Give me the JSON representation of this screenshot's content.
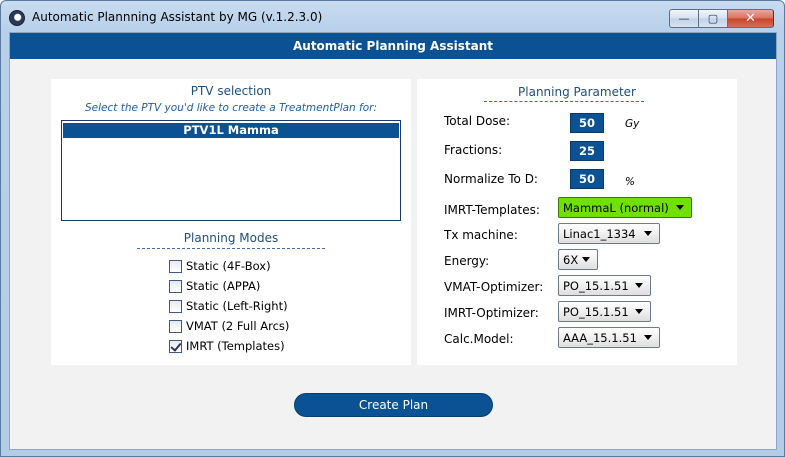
{
  "window": {
    "title": "Automatic Plannning Assistant by MG (v.1.2.3.0)",
    "minimize_glyph": "—",
    "maximize_glyph": "▢",
    "close_glyph": "✕"
  },
  "banner": {
    "title": "Automatic Planning Assistant"
  },
  "ptv": {
    "title": "PTV selection",
    "subtitle": "Select the PTV you'd like to create a TreatmentPlan for:",
    "items": [
      {
        "label": "PTV1L Mamma",
        "selected": true
      }
    ]
  },
  "modes": {
    "title": "Planning Modes",
    "options": [
      {
        "label": "Static (4F-Box)",
        "checked": false
      },
      {
        "label": "Static (APPA)",
        "checked": false
      },
      {
        "label": "Static (Left-Right)",
        "checked": false
      },
      {
        "label": "VMAT (2 Full Arcs)",
        "checked": false
      },
      {
        "label": "IMRT (Templates)",
        "checked": true
      }
    ]
  },
  "params": {
    "title": "Planning Parameter",
    "total_dose": {
      "label": "Total Dose:",
      "value": "50",
      "unit": "Gy"
    },
    "fractions": {
      "label": "Fractions:",
      "value": "25"
    },
    "normalize": {
      "label": "Normalize To D:",
      "value": "50",
      "unit": "%"
    },
    "imrt_templates": {
      "label": "IMRT-Templates:",
      "value": "MammaL (normal)"
    },
    "tx_machine": {
      "label": "Tx machine:",
      "value": "Linac1_1334"
    },
    "energy": {
      "label": "Energy:",
      "value": "6X"
    },
    "vmat_optimizer": {
      "label": "VMAT-Optimizer:",
      "value": "PO_15.1.51"
    },
    "imrt_optimizer": {
      "label": "IMRT-Optimizer:",
      "value": "PO_15.1.51"
    },
    "calc_model": {
      "label": "Calc.Model:",
      "value": "AAA_15.1.51"
    }
  },
  "actions": {
    "create_label": "Create Plan"
  },
  "colors": {
    "accent": "#0a5294",
    "template_highlight": "#70e000",
    "heading": "#1f4e79"
  }
}
